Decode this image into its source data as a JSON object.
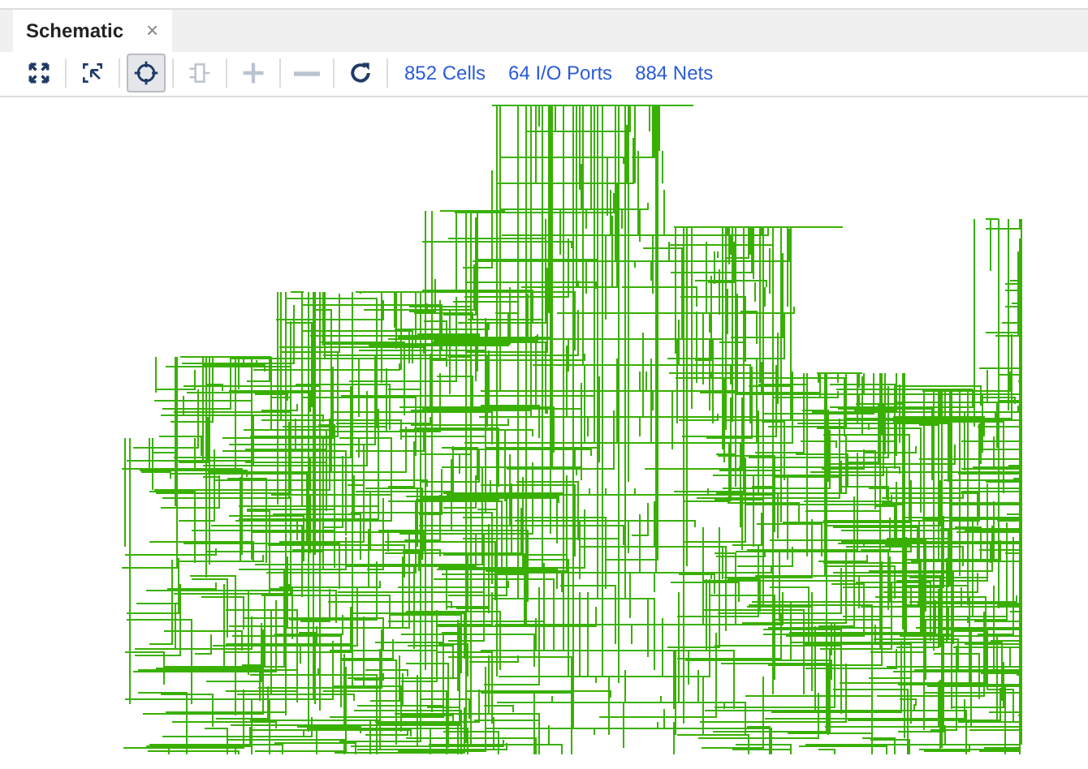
{
  "tabs": [
    {
      "label": "Schematic",
      "close": "×",
      "selected": true
    }
  ],
  "toolbar": [
    {
      "kind": "fit",
      "selected": false,
      "disabled": false
    },
    {
      "kind": "zoom-area",
      "selected": false,
      "disabled": false
    },
    {
      "kind": "select",
      "selected": true,
      "disabled": false
    },
    {
      "kind": "cell",
      "selected": false,
      "disabled": true
    },
    {
      "kind": "plus",
      "selected": false,
      "disabled": true
    },
    {
      "kind": "minus",
      "selected": false,
      "disabled": true
    },
    {
      "kind": "refresh",
      "selected": false,
      "disabled": false
    }
  ],
  "stats": [
    "852 Cells",
    "64 I/O Ports",
    "884 Nets"
  ]
}
